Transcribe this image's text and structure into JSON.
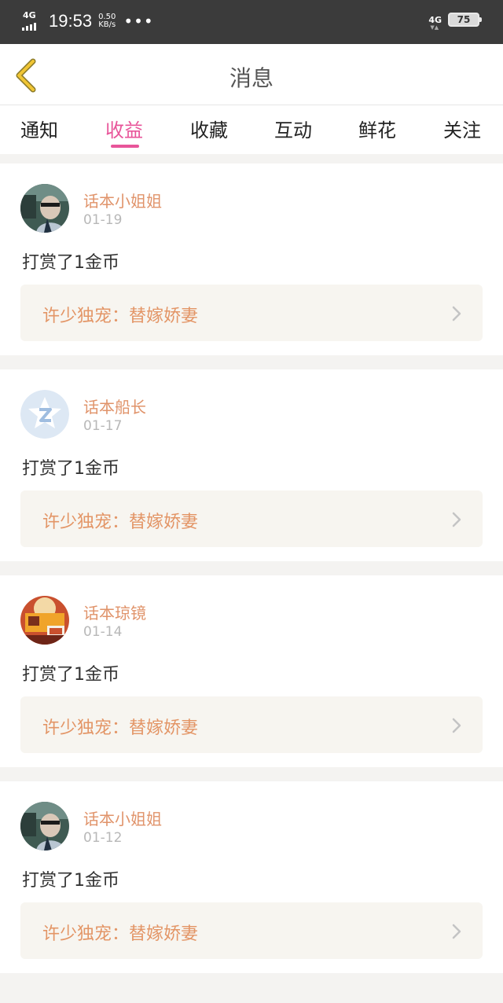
{
  "status_bar": {
    "network": "4G",
    "time": "19:53",
    "speed_value": "0.50",
    "speed_unit": "KB/s",
    "more": "•••",
    "network_right": "4G",
    "battery": "75"
  },
  "header": {
    "title": "消息"
  },
  "tabs": [
    {
      "label": "通知"
    },
    {
      "label": "收益"
    },
    {
      "label": "收藏"
    },
    {
      "label": "互动"
    },
    {
      "label": "鲜花"
    },
    {
      "label": "关注"
    }
  ],
  "active_tab": "收益",
  "colors": {
    "accent": "#e8559a",
    "name": "#e0936a",
    "link_text": "#e39566",
    "back_icon": "#e8bc2c"
  },
  "messages": [
    {
      "name": "话本小姐姐",
      "date": "01-19",
      "text": "打赏了1金币",
      "book": "许少独宠：替嫁娇妻",
      "avatar": "photo-avatar"
    },
    {
      "name": "话本船长",
      "date": "01-17",
      "text": "打赏了1金币",
      "book": "许少独宠：替嫁娇妻",
      "avatar": "default-z-avatar"
    },
    {
      "name": "话本琼镜",
      "date": "01-14",
      "text": "打赏了1金币",
      "book": "许少独宠：替嫁娇妻",
      "avatar": "cartoon-avatar"
    },
    {
      "name": "话本小姐姐",
      "date": "01-12",
      "text": "打赏了1金币",
      "book": "许少独宠：替嫁娇妻",
      "avatar": "photo-avatar"
    }
  ]
}
